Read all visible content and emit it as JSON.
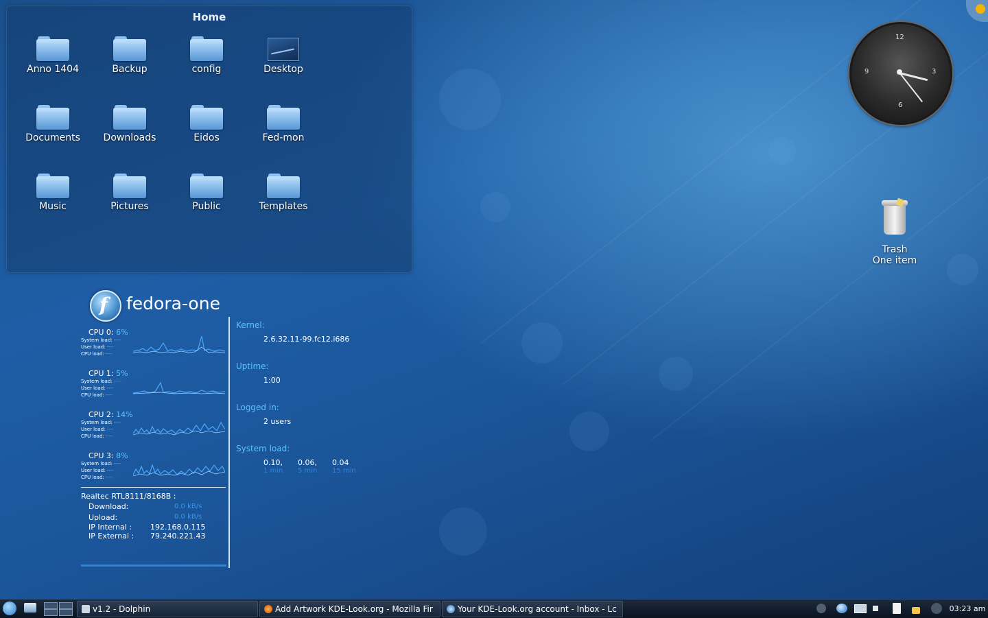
{
  "folderview": {
    "title": "Home",
    "items": [
      {
        "label": "Anno 1404",
        "icon": "folder-icon"
      },
      {
        "label": "Backup",
        "icon": "folder-icon"
      },
      {
        "label": "config",
        "icon": "folder-icon"
      },
      {
        "label": "Desktop",
        "icon": "desktop-icon"
      },
      {
        "label": "Documents",
        "icon": "folder-icon"
      },
      {
        "label": "Downloads",
        "icon": "folder-icon"
      },
      {
        "label": "Eidos",
        "icon": "folder-icon"
      },
      {
        "label": "Fed-mon",
        "icon": "folder-icon"
      },
      {
        "label": "Music",
        "icon": "folder-icon"
      },
      {
        "label": "Pictures",
        "icon": "folder-icon"
      },
      {
        "label": "Public",
        "icon": "folder-icon"
      },
      {
        "label": "Templates",
        "icon": "folder-icon"
      }
    ]
  },
  "clock": {
    "numbers": {
      "twelve": "12",
      "three": "3",
      "six": "6",
      "nine": "9"
    }
  },
  "trash": {
    "label": "Trash",
    "count": "One item"
  },
  "sysmon": {
    "hostname": "fedora-one",
    "logo": "f",
    "cpus": [
      {
        "name": "CPU 0:",
        "pct": "6%"
      },
      {
        "name": "CPU 1:",
        "pct": "5%"
      },
      {
        "name": "CPU 2:",
        "pct": "14%"
      },
      {
        "name": "CPU 3:",
        "pct": "8%"
      }
    ],
    "sub_labels": {
      "system": "System load:",
      "user": "User load:",
      "cpu": "CPU load:",
      "system_v": "----",
      "user_v": "----",
      "cpu_v": "----"
    },
    "network": {
      "adapter": "Realtec RTL8111/8168B :",
      "download_label": "Download:",
      "download_value": "0.0 kB/s",
      "upload_label": "Upload:",
      "upload_value": "0.0 kB/s",
      "ip_internal_label": "IP Internal :",
      "ip_internal": "192.168.0.115",
      "ip_external_label": "IP External :",
      "ip_external": "79.240.221.43"
    },
    "info": {
      "kernel_label": "Kernel:",
      "kernel": "2.6.32.11-99.fc12.i686",
      "uptime_label": "Uptime:",
      "uptime": "1:00",
      "logged_label": "Logged in:",
      "logged": "2 users",
      "load_label": "System load:",
      "load_1": "0.10,",
      "load_5": "0.06,",
      "load_15": "0.04",
      "cap_1": "1 min",
      "cap_5": "5 min",
      "cap_15": "15 min"
    }
  },
  "taskbar": {
    "tasks": [
      {
        "label": "v1.2 - Dolphin",
        "icon": "dolphin-icon"
      },
      {
        "label": "Add Artwork KDE-Look.org - Mozilla Fir",
        "icon": "firefox-icon"
      },
      {
        "label": "Your KDE-Look.org account - Inbox - Lc",
        "icon": "mail-icon"
      }
    ],
    "time": "03:23 am"
  },
  "colors": {
    "accent": "#5fc1ff",
    "panel": "#0b1420"
  }
}
